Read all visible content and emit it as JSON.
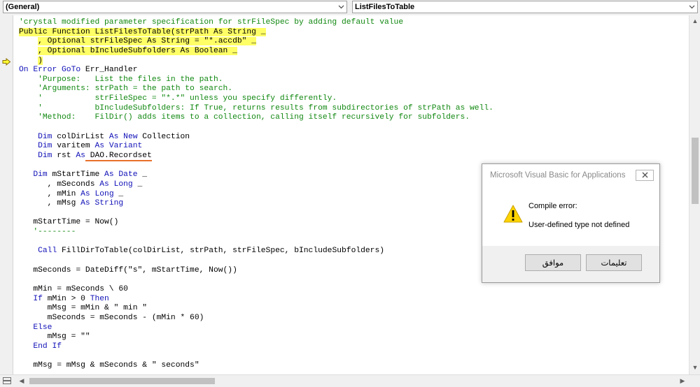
{
  "toolbar": {
    "object_combo": "(General)",
    "procedure_combo": "ListFilesToTable"
  },
  "code_lines": [
    [
      {
        "t": "'crystal modified parameter specification for strFileSpec by adding default value",
        "c": "cm"
      }
    ],
    [
      {
        "t": "Public Function ListFilesToTable(strPath As String _",
        "c": "hl"
      }
    ],
    [
      {
        "t": "    ",
        "c": ""
      },
      {
        "t": ", Optional strFileSpec As String = \"*.accdb\" _",
        "c": "hl"
      }
    ],
    [
      {
        "t": "    ",
        "c": ""
      },
      {
        "t": ", Optional bIncludeSubfolders As Boolean _",
        "c": "hl"
      }
    ],
    [
      {
        "t": "    ",
        "c": ""
      },
      {
        "t": ")",
        "c": "hl"
      }
    ],
    [
      {
        "t": "On Error GoTo ",
        "c": "kw"
      },
      {
        "t": "Err_Handler",
        "c": ""
      }
    ],
    [
      {
        "t": "    'Purpose:   List the files in the path.",
        "c": "cm"
      }
    ],
    [
      {
        "t": "    'Arguments: strPath = the path to search.",
        "c": "cm"
      }
    ],
    [
      {
        "t": "    '           strFileSpec = \"*.*\" unless you specify differently.",
        "c": "cm"
      }
    ],
    [
      {
        "t": "    '           bIncludeSubfolders: If True, returns results from subdirectories of strPath as well.",
        "c": "cm"
      }
    ],
    [
      {
        "t": "    'Method:    FilDir() adds items to a collection, calling itself recursively for subfolders.",
        "c": "cm"
      }
    ],
    [
      {
        "t": "",
        "c": ""
      }
    ],
    [
      {
        "t": "    ",
        "c": ""
      },
      {
        "t": "Dim ",
        "c": "kw"
      },
      {
        "t": "colDirList ",
        "c": ""
      },
      {
        "t": "As New ",
        "c": "kw"
      },
      {
        "t": "Collection",
        "c": ""
      }
    ],
    [
      {
        "t": "    ",
        "c": ""
      },
      {
        "t": "Dim ",
        "c": "kw"
      },
      {
        "t": "varitem ",
        "c": ""
      },
      {
        "t": "As Variant",
        "c": "kw"
      }
    ],
    [
      {
        "t": "    ",
        "c": ""
      },
      {
        "t": "Dim ",
        "c": "kw"
      },
      {
        "t": "rst ",
        "c": ""
      },
      {
        "t": "As",
        "c": "kw"
      },
      {
        "t": " DAO.Recordset",
        "c": "squiggle"
      }
    ],
    [
      {
        "t": "",
        "c": ""
      }
    ],
    [
      {
        "t": "   ",
        "c": ""
      },
      {
        "t": "Dim ",
        "c": "kw"
      },
      {
        "t": "mStartTime ",
        "c": ""
      },
      {
        "t": "As Date",
        "c": "kw"
      },
      {
        "t": " _",
        "c": ""
      }
    ],
    [
      {
        "t": "      , mSeconds ",
        "c": ""
      },
      {
        "t": "As Long",
        "c": "kw"
      },
      {
        "t": " _",
        "c": ""
      }
    ],
    [
      {
        "t": "      , mMin ",
        "c": ""
      },
      {
        "t": "As Long",
        "c": "kw"
      },
      {
        "t": " _",
        "c": ""
      }
    ],
    [
      {
        "t": "      , mMsg ",
        "c": ""
      },
      {
        "t": "As String",
        "c": "kw"
      }
    ],
    [
      {
        "t": "",
        "c": ""
      }
    ],
    [
      {
        "t": "   mStartTime = Now()",
        "c": ""
      }
    ],
    [
      {
        "t": "   '--------",
        "c": "cm"
      }
    ],
    [
      {
        "t": "",
        "c": ""
      }
    ],
    [
      {
        "t": "    ",
        "c": ""
      },
      {
        "t": "Call ",
        "c": "kw"
      },
      {
        "t": "FillDirToTable(colDirList, strPath, strFileSpec, bIncludeSubfolders)",
        "c": ""
      }
    ],
    [
      {
        "t": "",
        "c": ""
      }
    ],
    [
      {
        "t": "   mSeconds = DateDiff(\"s\", mStartTime, Now())",
        "c": ""
      }
    ],
    [
      {
        "t": "",
        "c": ""
      }
    ],
    [
      {
        "t": "   mMin = mSeconds \\ 60",
        "c": ""
      }
    ],
    [
      {
        "t": "   ",
        "c": ""
      },
      {
        "t": "If ",
        "c": "kw"
      },
      {
        "t": "mMin > 0 ",
        "c": ""
      },
      {
        "t": "Then",
        "c": "kw"
      }
    ],
    [
      {
        "t": "      mMsg = mMin & \" min \"",
        "c": ""
      }
    ],
    [
      {
        "t": "      mSeconds = mSeconds - (mMin * 60)",
        "c": ""
      }
    ],
    [
      {
        "t": "   ",
        "c": ""
      },
      {
        "t": "Else",
        "c": "kw"
      }
    ],
    [
      {
        "t": "      mMsg = \"\"",
        "c": ""
      }
    ],
    [
      {
        "t": "   ",
        "c": ""
      },
      {
        "t": "End If",
        "c": "kw"
      }
    ],
    [
      {
        "t": "",
        "c": ""
      }
    ],
    [
      {
        "t": "   mMsg = mMsg & mSeconds & \" seconds\"",
        "c": ""
      }
    ]
  ],
  "dialog": {
    "title": "Microsoft Visual Basic for Applications",
    "message_heading": "Compile error:",
    "message_detail": "User-defined type not defined",
    "ok_label": "موافق",
    "help_label": "تعليمات"
  },
  "colors": {
    "keyword": "#1010b8",
    "comment": "#118811",
    "highlight": "#ffff66",
    "error_squiggle": "#e8702a"
  }
}
